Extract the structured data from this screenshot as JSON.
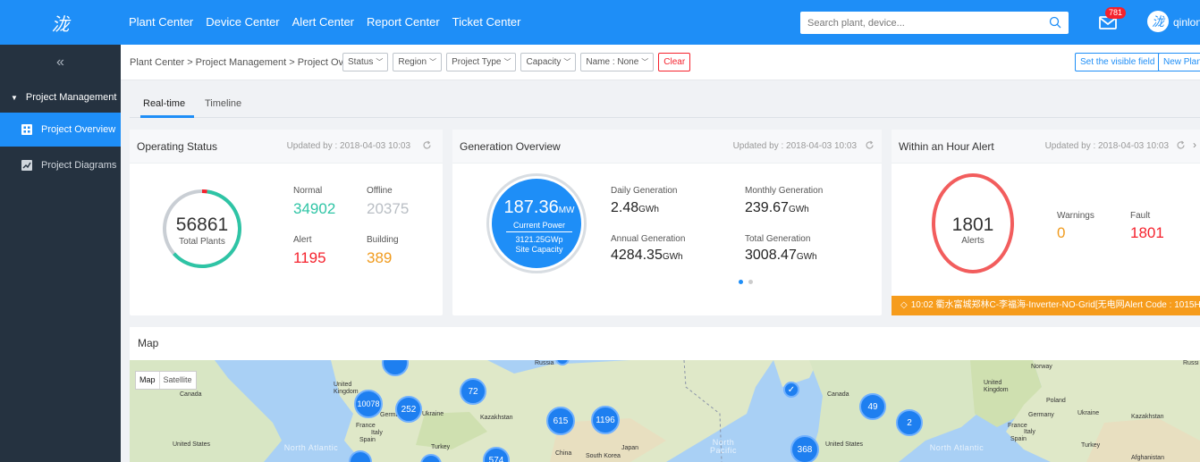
{
  "app": {
    "logo_text": "泷"
  },
  "topnav": [
    "Plant Center",
    "Device Center",
    "Alert Center",
    "Report Center",
    "Ticket Center"
  ],
  "search": {
    "placeholder": "Search plant, device..."
  },
  "notifications": {
    "count": "781"
  },
  "user": {
    "name": "qinlong"
  },
  "sidebar": {
    "collapse_icon": "«",
    "group": "Project Management",
    "items": [
      {
        "label": "Project Overview",
        "active": true,
        "icon": "grid-icon"
      },
      {
        "label": "Project Diagrams",
        "active": false,
        "icon": "chart-icon"
      }
    ]
  },
  "breadcrumb": "Plant Center > Project Management > Project Overview >",
  "filters": [
    "Status",
    "Region",
    "Project Type",
    "Capacity",
    "Name : None"
  ],
  "clear_label": "Clear",
  "actions": {
    "visible_field": "Set the visible field",
    "new_plant": "New Plant"
  },
  "tabs": [
    "Real-time",
    "Timeline"
  ],
  "operating": {
    "title": "Operating Status",
    "updated": "Updated by : 2018-04-03 10:03",
    "total": "56861",
    "total_label": "Total Plants",
    "normal_label": "Normal",
    "normal": "34902",
    "offline_label": "Offline",
    "offline": "20375",
    "alert_label": "Alert",
    "alert": "1195",
    "building_label": "Building",
    "building": "389"
  },
  "generation": {
    "title": "Generation Overview",
    "updated": "Updated by : 2018-04-03 10:03",
    "power": "187.36",
    "power_unit": "MW",
    "power_label": "Current Power",
    "capacity": "3121.25GWp",
    "capacity_label": "Site Capacity",
    "daily_label": "Daily Generation",
    "daily": "2.48",
    "monthly_label": "Monthly Generation",
    "monthly": "239.67",
    "annual_label": "Annual Generation",
    "annual": "4284.35",
    "total_label": "Total Generation",
    "total": "3008.47",
    "unit": "GWh"
  },
  "alerts": {
    "title": "Within an Hour Alert",
    "updated": "Updated by : 2018-04-03 10:03",
    "count": "1801",
    "count_label": "Alerts",
    "warnings_label": "Warnings",
    "warnings": "0",
    "fault_label": "Fault",
    "fault": "1801",
    "ticker": "10:02 衢水富城郑林C-李福海-Inverter-NO-Grid[无电网Alert Code : 1015H"
  },
  "map": {
    "title": "Map",
    "toggle": [
      "Map",
      "Satellite"
    ],
    "clusters": [
      "10078",
      "252",
      "72",
      "615",
      "1196",
      "49",
      "2",
      "368",
      "574"
    ],
    "labels": {
      "russia": "Russia",
      "russia2": "Russi",
      "canada": "Canada",
      "canada2": "Canada",
      "uk": "United Kingdom",
      "uk2": "United Kingdom",
      "germany": "Germany",
      "germany2": "Germany",
      "ukraine": "Ukraine",
      "ukraine2": "Ukraine",
      "france": "France",
      "france2": "France",
      "italy": "Italy",
      "italy2": "Italy",
      "spain": "Spain",
      "spain2": "Spain",
      "kazakhstan": "Kazakhstan",
      "kazakhstan2": "Kazakhstan",
      "us": "United States",
      "us2": "United States",
      "turkey": "Turkey",
      "turkey2": "Turkey",
      "china": "China",
      "japan": "Japan",
      "skorea": "South Korea",
      "norway": "Norway",
      "poland": "Poland",
      "afghanistan": "Afghanistan",
      "north_atlantic": "North Atlantic",
      "north_atlantic2": "North Atlantic",
      "north_pacific": "North Pacific"
    }
  },
  "colors": {
    "primary": "#1e8ef7",
    "normal": "#2ec4a5",
    "offline": "#b9bec4",
    "alert": "#f5222d",
    "building": "#f09b1e",
    "alert_ring": "#f25d5d"
  }
}
